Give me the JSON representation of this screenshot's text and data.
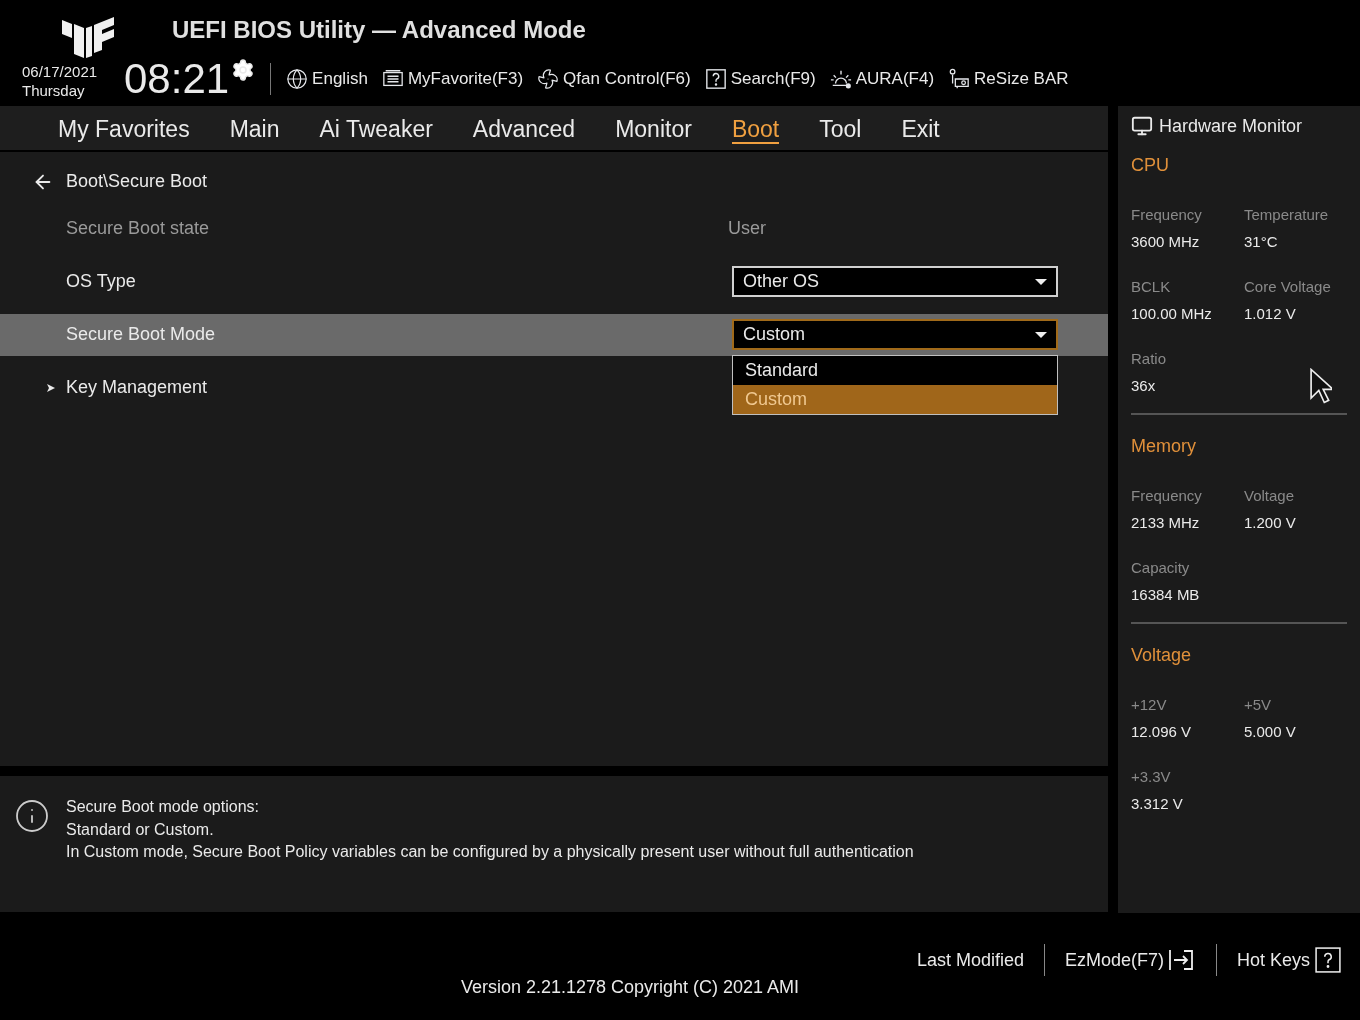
{
  "header": {
    "title": "UEFI BIOS Utility — Advanced Mode",
    "date": "06/17/2021",
    "day": "Thursday",
    "time": "08:21",
    "tools": [
      {
        "kind": "language",
        "label": "English"
      },
      {
        "kind": "favorite",
        "label": "MyFavorite(F3)"
      },
      {
        "kind": "fan",
        "label": "Qfan Control(F6)"
      },
      {
        "kind": "search",
        "label": "Search(F9)"
      },
      {
        "kind": "aura",
        "label": "AURA(F4)"
      },
      {
        "kind": "resize",
        "label": "ReSize BAR"
      }
    ]
  },
  "tabs": [
    {
      "label": "My Favorites",
      "selected": false
    },
    {
      "label": "Main",
      "selected": false
    },
    {
      "label": "Ai Tweaker",
      "selected": false
    },
    {
      "label": "Advanced",
      "selected": false
    },
    {
      "label": "Monitor",
      "selected": false
    },
    {
      "label": "Boot",
      "selected": true
    },
    {
      "label": "Tool",
      "selected": false
    },
    {
      "label": "Exit",
      "selected": false
    }
  ],
  "breadcrumb": "Boot\\Secure Boot",
  "settings": [
    {
      "kind": "info",
      "label": "Secure Boot state",
      "value": "User",
      "selected": false
    },
    {
      "kind": "dropdown",
      "label": "OS Type",
      "value": "Other OS",
      "selected": false,
      "expanded": false
    },
    {
      "kind": "dropdown",
      "label": "Secure Boot Mode",
      "value": "Custom",
      "selected": true,
      "expanded": true,
      "options": [
        {
          "label": "Standard",
          "selected": false
        },
        {
          "label": "Custom",
          "selected": true
        }
      ]
    },
    {
      "kind": "submenu",
      "label": "Key Management",
      "selected": false
    }
  ],
  "help": [
    "Secure Boot mode options:",
    "Standard or Custom.",
    "In Custom mode, Secure Boot Policy variables can be configured by a physically present user without full authentication"
  ],
  "hardware_monitor": {
    "title": "Hardware Monitor",
    "sections": [
      {
        "title": "CPU",
        "items": [
          {
            "label": "Frequency",
            "value": "3600 MHz"
          },
          {
            "label": "Temperature",
            "value": "31°C"
          },
          {
            "label": "BCLK",
            "value": "100.00 MHz"
          },
          {
            "label": "Core Voltage",
            "value": "1.012 V"
          },
          {
            "label": "Ratio",
            "value": "36x"
          }
        ]
      },
      {
        "title": "Memory",
        "items": [
          {
            "label": "Frequency",
            "value": "2133 MHz"
          },
          {
            "label": "Voltage",
            "value": "1.200 V"
          },
          {
            "label": "Capacity",
            "value": "16384 MB"
          }
        ]
      },
      {
        "title": "Voltage",
        "items": [
          {
            "label": "+12V",
            "value": "12.096 V"
          },
          {
            "label": "+5V",
            "value": "5.000 V"
          },
          {
            "label": "+3.3V",
            "value": "3.312 V"
          }
        ]
      }
    ]
  },
  "footer": {
    "buttons": [
      {
        "kind": "plain",
        "label": "Last Modified"
      },
      {
        "kind": "ezmode",
        "label": "EzMode(F7)"
      },
      {
        "kind": "hotkeys",
        "label": "Hot Keys"
      }
    ],
    "version": "Version 2.21.1278 Copyright (C) 2021 AMI"
  }
}
